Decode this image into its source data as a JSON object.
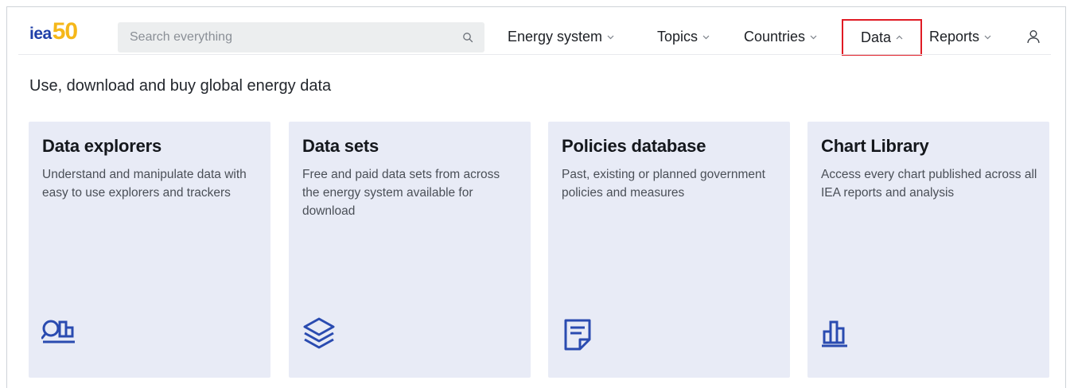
{
  "header": {
    "logo": {
      "text_iea": "iea",
      "text_50": "50"
    },
    "search": {
      "placeholder": "Search everything",
      "value": ""
    },
    "nav": [
      {
        "label": "Energy system",
        "icon": "chevron-down-icon"
      },
      {
        "label": "Topics",
        "icon": "chevron-down-icon"
      },
      {
        "label": "Countries",
        "icon": "chevron-down-icon"
      },
      {
        "label": "Data",
        "icon": "chevron-up-icon",
        "active": true,
        "highlight_color": "#e01b24"
      },
      {
        "label": "Reports",
        "icon": "chevron-down-icon"
      }
    ],
    "user_icon": "user-icon"
  },
  "intro": "Use, download and buy global energy data",
  "cards": [
    {
      "title": "Data explorers",
      "description": "Understand and manipulate data with easy to use explorers and trackers",
      "icon": "data-explorer-icon"
    },
    {
      "title": "Data sets",
      "description": "Free and paid data sets from across the energy system available for download",
      "icon": "layers-icon"
    },
    {
      "title": "Policies database",
      "description": "Past, existing or planned government policies and measures",
      "icon": "document-icon"
    },
    {
      "title": "Chart Library",
      "description": "Access every chart published across all IEA reports and analysis",
      "icon": "bar-chart-icon"
    }
  ],
  "colors": {
    "brand_blue": "#1f3fa8",
    "brand_yellow": "#f5b719",
    "card_background": "#e8ebf6",
    "icon_blue": "#2a4bb0",
    "highlight_red": "#e01b24"
  }
}
